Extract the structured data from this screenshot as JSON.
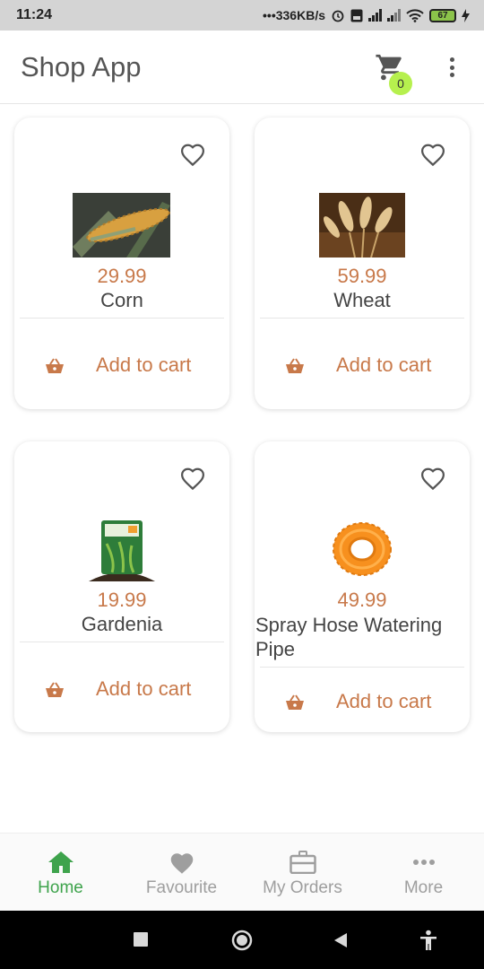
{
  "status_bar": {
    "time": "11:24",
    "network_speed": "336KB/s",
    "battery": "67",
    "icons": [
      "alarm-icon",
      "volte-icon",
      "signal-icon",
      "signal-icon",
      "wifi-icon",
      "battery-icon",
      "charging-icon"
    ]
  },
  "app_bar": {
    "title": "Shop App",
    "cart_count": "0",
    "icons": [
      "cart-icon",
      "more-vertical-icon"
    ]
  },
  "products": [
    {
      "price": "29.99",
      "name": "Corn",
      "action": "Add to cart",
      "image": "corn-photo"
    },
    {
      "price": "59.99",
      "name": "Wheat",
      "action": "Add to cart",
      "image": "wheat-photo"
    },
    {
      "price": "19.99",
      "name": "Gardenia",
      "action": "Add to cart",
      "image": "vermicompost-bag-photo"
    },
    {
      "price": "49.99",
      "name": "Spray Hose Watering Pipe",
      "action": "Add to cart",
      "image": "orange-hose-photo"
    }
  ],
  "bottom_nav": {
    "items": [
      {
        "label": "Home",
        "icon": "home-icon",
        "active": true
      },
      {
        "label": "Favourite",
        "icon": "heart-icon",
        "active": false
      },
      {
        "label": "My Orders",
        "icon": "briefcase-icon",
        "active": false
      },
      {
        "label": "More",
        "icon": "more-horizontal-icon",
        "active": false
      }
    ]
  },
  "colors": {
    "accent": "#c8794a",
    "active_nav": "#3ea34c",
    "badge": "#b6f04e",
    "text": "#444444"
  }
}
